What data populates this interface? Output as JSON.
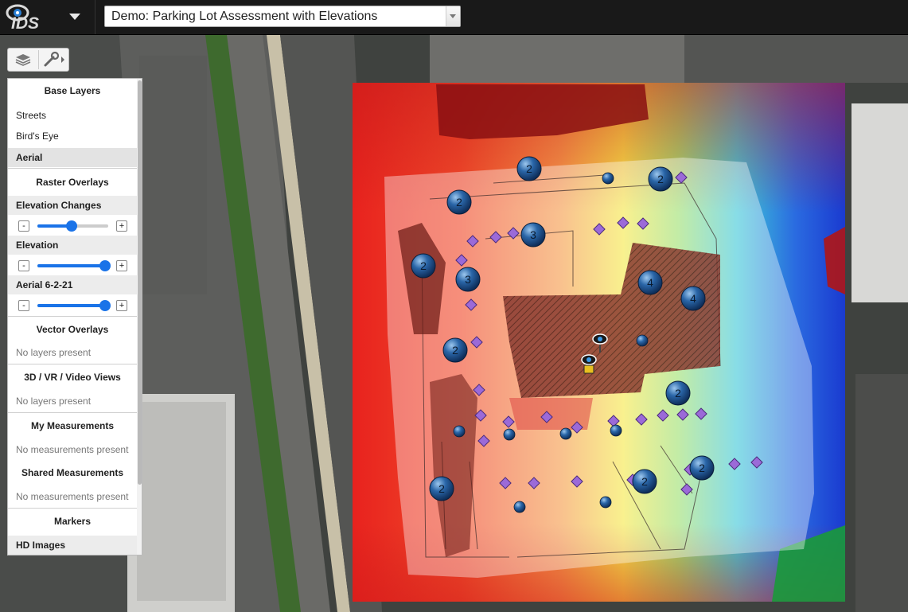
{
  "header": {
    "logo_text": "IDS",
    "project_selected": "Demo: Parking Lot Assessment with Elevations"
  },
  "toolbar": {
    "layers_icon": "layers-icon",
    "tools_icon": "wrench-icon"
  },
  "panel": {
    "base_layers": {
      "title": "Base Layers",
      "items": [
        "Streets",
        "Bird's Eye",
        "Aerial"
      ],
      "selected": "Aerial"
    },
    "raster_overlays": {
      "title": "Raster Overlays",
      "layers": [
        {
          "name": "Elevation Changes",
          "opacity": 0.48
        },
        {
          "name": "Elevation",
          "opacity": 0.95
        },
        {
          "name": "Aerial 6-2-21",
          "opacity": 0.95
        }
      ]
    },
    "vector_overlays": {
      "title": "Vector Overlays",
      "empty": "No layers present"
    },
    "views": {
      "title": "3D / VR / Video Views",
      "empty": "No layers present"
    },
    "my_measurements": {
      "title": "My Measurements",
      "empty": "No measurements present"
    },
    "shared_measurements": {
      "title": "Shared Measurements",
      "empty": "No measurements present"
    },
    "markers": {
      "title": "Markers",
      "items": [
        "HD Images"
      ]
    },
    "minus": "-",
    "plus": "+"
  },
  "map": {
    "cluster_markers": [
      "2",
      "2",
      "2",
      "3",
      "2",
      "3",
      "4",
      "4",
      "2",
      "2",
      "2",
      "2",
      "2"
    ]
  }
}
